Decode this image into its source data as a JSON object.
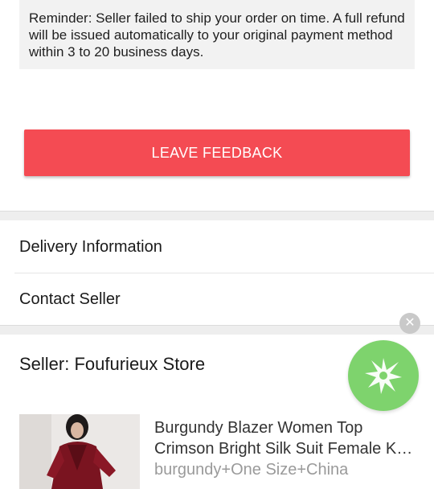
{
  "notice": {
    "text": "Reminder: Seller failed to ship your order on time. A full refund will be issued automatically to your original payment method within 3 to 20 business days."
  },
  "feedback": {
    "button_label": "LEAVE FEEDBACK"
  },
  "menu": {
    "delivery_label": "Delivery Information",
    "contact_label": "Contact Seller"
  },
  "seller": {
    "name": "Seller: Foufurieux Store"
  },
  "product": {
    "title_line1": "Burgundy Blazer Women Top",
    "title_line2": "Crimson Bright Silk Suit Female K…",
    "variant": "burgundy+One Size+China"
  },
  "icons": {
    "close": "close-icon",
    "promo": "sparkle-icon"
  },
  "colors": {
    "accent": "#f44b53",
    "promo_green": "#7ed36d"
  }
}
